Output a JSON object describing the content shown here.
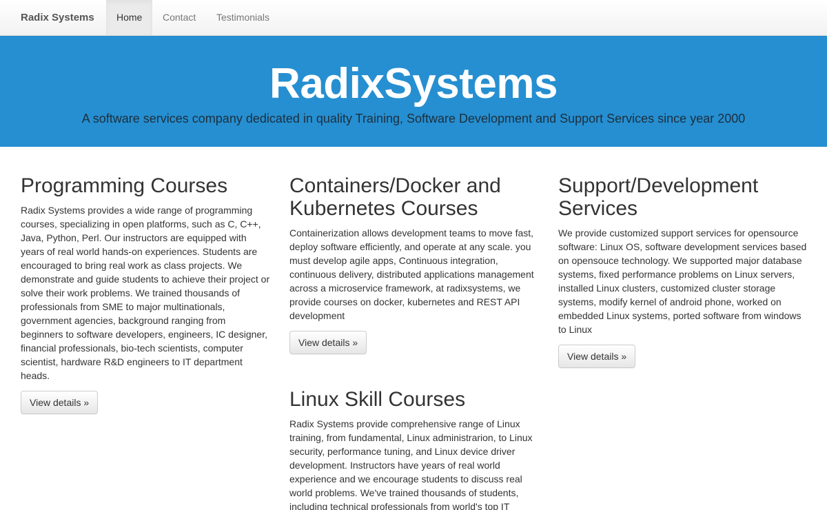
{
  "navbar": {
    "brand": "Radix Systems",
    "items": [
      {
        "label": "Home",
        "active": true
      },
      {
        "label": "Contact",
        "active": false
      },
      {
        "label": "Testimonials",
        "active": false
      }
    ]
  },
  "jumbotron": {
    "title": "RadixSystems",
    "subtitle": "A software services company dedicated in quality Training, Software Development and Support Services since year 2000"
  },
  "sections": {
    "programming": {
      "title": "Programming Courses",
      "body": "Radix Systems provides a wide range of programming courses, specializing in open platforms, such as C, C++, Java, Python, Perl. Our instructors are equipped with years of real world hands-on experiences. Students are encouraged to bring real work as class projects. We demonstrate and guide students to achieve their project or solve their work problems. We trained thousands of professionals from SME to major multinationals, government agencies, background ranging from beginners to software developers, engineers, IC designer, financial professionals, bio-tech scientists, computer scientist, hardware R&D engineers to IT department heads.",
      "button": "View details »"
    },
    "containers": {
      "title": "Containers/Docker and Kubernetes Courses",
      "body": "Containerization allows development teams to move fast, deploy software efficiently, and operate at any scale. you must develop agile apps, Continuous integration, continuous delivery, distributed applications management across a microservice framework, at radixsystems, we provide courses on docker, kubernetes and REST API development",
      "button": "View details »"
    },
    "support": {
      "title": "Support/Development Services",
      "body": "We provide customized support services for opensource software: Linux OS, software development services based on opensouce technology. We supported major database systems, fixed performance problems on Linux servers, installed Linux clusters, customized cluster storage systems, modify kernel of android phone, worked on embedded Linux systems, ported software from windows to Linux",
      "button": "View details »"
    },
    "linux": {
      "title": "Linux Skill Courses",
      "body": "Radix Systems provide comprehensive range of Linux training, from fundamental, Linux administrarion, to Linux security, performance tuning, and Linux device driver development. Instructors have years of real world experience and we encourage students to discuss real world problems. We've trained thousands of students, including technical professionals from world's top IT"
    }
  }
}
